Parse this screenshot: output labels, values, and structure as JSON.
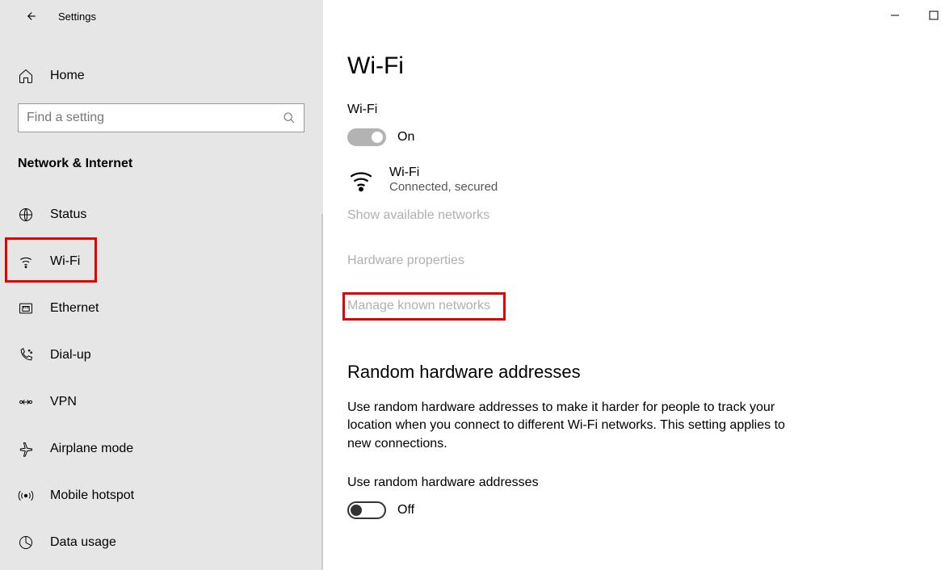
{
  "app": {
    "title": "Settings"
  },
  "sidebar": {
    "home": "Home",
    "searchPlaceholder": "Find a setting",
    "category": "Network & Internet",
    "items": [
      {
        "key": "status",
        "label": "Status"
      },
      {
        "key": "wifi",
        "label": "Wi-Fi"
      },
      {
        "key": "ethernet",
        "label": "Ethernet"
      },
      {
        "key": "dialup",
        "label": "Dial-up"
      },
      {
        "key": "vpn",
        "label": "VPN"
      },
      {
        "key": "airplane",
        "label": "Airplane mode"
      },
      {
        "key": "hotspot",
        "label": "Mobile hotspot"
      },
      {
        "key": "datausage",
        "label": "Data usage"
      }
    ]
  },
  "main": {
    "pageTitle": "Wi-Fi",
    "wifiToggle": {
      "label": "Wi-Fi",
      "status": "On",
      "on": true
    },
    "connection": {
      "name": "Wi-Fi",
      "desc": "Connected, secured"
    },
    "links": {
      "available": "Show available networks",
      "hardware": "Hardware properties",
      "manage": "Manage known networks"
    },
    "randomSection": {
      "heading": "Random hardware addresses",
      "body": "Use random hardware addresses to make it harder for people to track your location when you connect to different Wi-Fi networks. This setting applies to new connections.",
      "toggleLabel": "Use random hardware addresses",
      "status": "Off",
      "on": false
    }
  }
}
